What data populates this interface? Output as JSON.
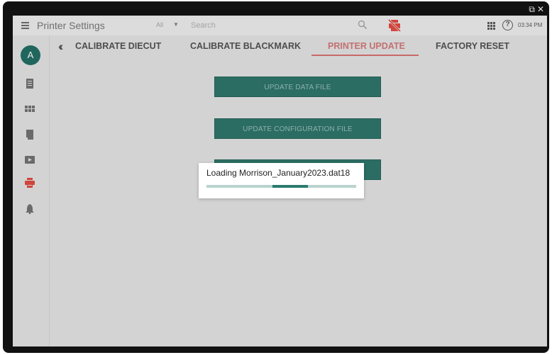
{
  "window": {
    "popout_icon": "popout-icon",
    "close_icon": "close-icon",
    "close_glyph": "✕",
    "popout_glyph": "⧉"
  },
  "topbar": {
    "title": "Printer Settings",
    "filter_value": "All",
    "search_placeholder": "Search",
    "clock": "03:34 PM",
    "icons": [
      "menu-icon",
      "search-icon",
      "no-print-icon",
      "apps-grid-icon",
      "help-icon"
    ]
  },
  "sidebar": {
    "avatar_letter": "A",
    "items": [
      {
        "icon": "document-icon"
      },
      {
        "icon": "grid-icon"
      },
      {
        "icon": "label-roll-icon"
      },
      {
        "icon": "video-folder-icon"
      },
      {
        "icon": "printer-icon",
        "active": true
      },
      {
        "icon": "bell-icon"
      }
    ]
  },
  "tabs": [
    {
      "label": "CALIBRATE DIECUT"
    },
    {
      "label": "CALIBRATE BLACKMARK"
    },
    {
      "label": "PRINTER UPDATE",
      "active": true
    },
    {
      "label": "FACTORY RESET"
    }
  ],
  "buttons": {
    "update_data_file": "UPDATE DATA FILE",
    "update_configuration_file": "UPDATE CONFIGURATION FILE",
    "hidden_third_button": ""
  },
  "loading_dialog": {
    "message": "Loading Morrison_January2023.dat18",
    "progress_indicator": "indeterminate",
    "bar_segment_start": 0.44,
    "bar_segment_end": 0.68
  },
  "colors": {
    "accent_teal": "#2b6d63",
    "active_tab": "#c47070",
    "active_icon": "#d0453c",
    "background_dim": "#d3d3d3"
  }
}
